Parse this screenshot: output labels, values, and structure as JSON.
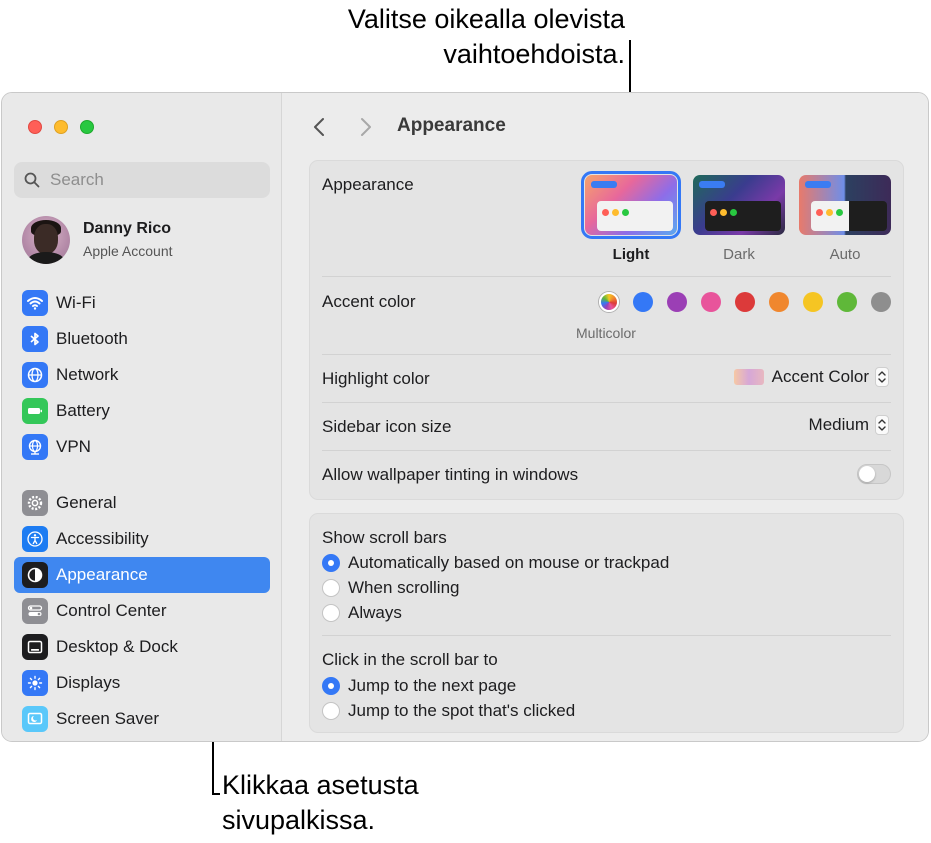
{
  "callouts": {
    "top": "Valitse oikealla olevista vaihtoehdoista.",
    "bottom": "Klikkaa asetusta sivupalkissa."
  },
  "sidebar": {
    "search_placeholder": "Search",
    "profile": {
      "name": "Danny Rico",
      "subtitle": "Apple Account"
    },
    "group1": [
      {
        "label": "Wi-Fi",
        "icon": "wifi-icon",
        "color": "#3478f6"
      },
      {
        "label": "Bluetooth",
        "icon": "bluetooth-icon",
        "color": "#3478f6"
      },
      {
        "label": "Network",
        "icon": "globe-icon",
        "color": "#3478f6"
      },
      {
        "label": "Battery",
        "icon": "battery-icon",
        "color": "#34c759"
      },
      {
        "label": "VPN",
        "icon": "vpn-globe-icon",
        "color": "#3478f6"
      }
    ],
    "group2": [
      {
        "label": "General",
        "icon": "gear-icon",
        "color": "#8e8e93"
      },
      {
        "label": "Accessibility",
        "icon": "accessibility-icon",
        "color": "#1d7cf2"
      },
      {
        "label": "Appearance",
        "icon": "appearance-icon",
        "color": "#1d1d1f",
        "selected": true
      },
      {
        "label": "Control Center",
        "icon": "control-center-icon",
        "color": "#8e8e93"
      },
      {
        "label": "Desktop & Dock",
        "icon": "desktop-dock-icon",
        "color": "#1d1d1f"
      },
      {
        "label": "Displays",
        "icon": "displays-icon",
        "color": "#3478f6"
      },
      {
        "label": "Screen Saver",
        "icon": "screen-saver-icon",
        "color": "#5ac8fa"
      }
    ]
  },
  "header": {
    "title": "Appearance"
  },
  "appearance_panel": {
    "appearance_label": "Appearance",
    "modes": [
      {
        "label": "Light",
        "selected": true
      },
      {
        "label": "Dark",
        "selected": false
      },
      {
        "label": "Auto",
        "selected": false
      }
    ],
    "accent_label": "Accent color",
    "accent_colors": [
      "multicolor",
      "#3478f6",
      "#9b3fb5",
      "#e8549b",
      "#dc3a3a",
      "#f0872e",
      "#f5c523",
      "#5fb839",
      "#8e8e8e"
    ],
    "multicolor_caption": "Multicolor",
    "highlight_label": "Highlight color",
    "highlight_value": "Accent Color",
    "sidebar_icon_label": "Sidebar icon size",
    "sidebar_icon_value": "Medium",
    "tinting_label": "Allow wallpaper tinting in windows",
    "tinting_on": false
  },
  "scroll_panel": {
    "show_label": "Show scroll bars",
    "show_options": [
      {
        "label": "Automatically based on mouse or trackpad",
        "checked": true
      },
      {
        "label": "When scrolling",
        "checked": false
      },
      {
        "label": "Always",
        "checked": false
      }
    ],
    "click_label": "Click in the scroll bar to",
    "click_options": [
      {
        "label": "Jump to the next page",
        "checked": true
      },
      {
        "label": "Jump to the spot that's clicked",
        "checked": false
      }
    ]
  }
}
